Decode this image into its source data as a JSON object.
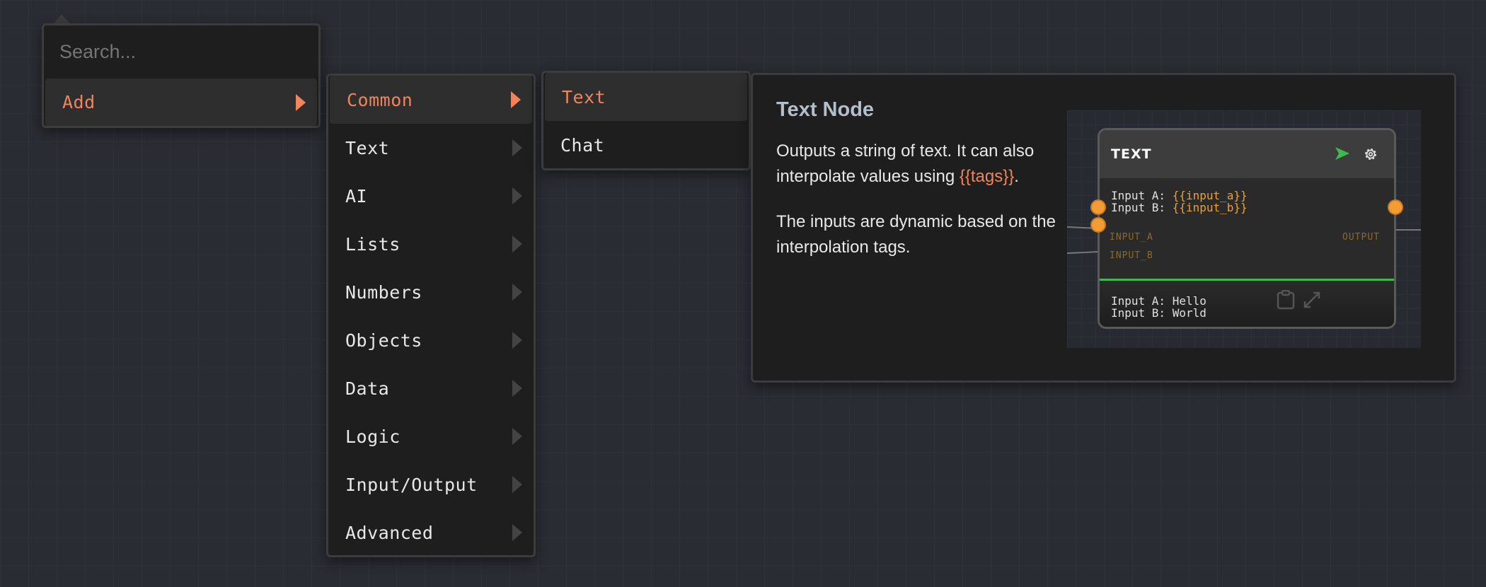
{
  "search": {
    "placeholder": "Search...",
    "items": [
      {
        "label": "Add",
        "active": true
      }
    ]
  },
  "categories": [
    {
      "label": "Common",
      "active": true
    },
    {
      "label": "Text"
    },
    {
      "label": "AI"
    },
    {
      "label": "Lists"
    },
    {
      "label": "Numbers"
    },
    {
      "label": "Objects"
    },
    {
      "label": "Data"
    },
    {
      "label": "Logic"
    },
    {
      "label": "Input/Output"
    },
    {
      "label": "Advanced"
    }
  ],
  "submenu": [
    {
      "label": "Text",
      "active": true
    },
    {
      "label": "Chat"
    }
  ],
  "info": {
    "title": "Text Node",
    "desc1_pre": "Outputs a string of text. It can also interpolate values using ",
    "desc1_tag": "{{tags}}",
    "desc1_post": ".",
    "desc2": "The inputs are dynamic based on the interpolation tags.",
    "preview": {
      "node_title": "TEXT",
      "line_a_label": "Input A: ",
      "line_a_value": "{{input_a}}",
      "line_b_label": "Input B: ",
      "line_b_value": "{{input_b}}",
      "port_in_a": "INPUT_A",
      "port_in_b": "INPUT_B",
      "port_out": "OUTPUT",
      "out_a": "Input A: Hello",
      "out_b": "Input B: World",
      "icons": [
        "send-icon",
        "gear-icon",
        "clipboard-icon",
        "expand-icon"
      ]
    }
  },
  "colors": {
    "accent": "#f0845c",
    "port": "#f39c33",
    "run": "#3fb950",
    "background": "#2a2c33"
  }
}
